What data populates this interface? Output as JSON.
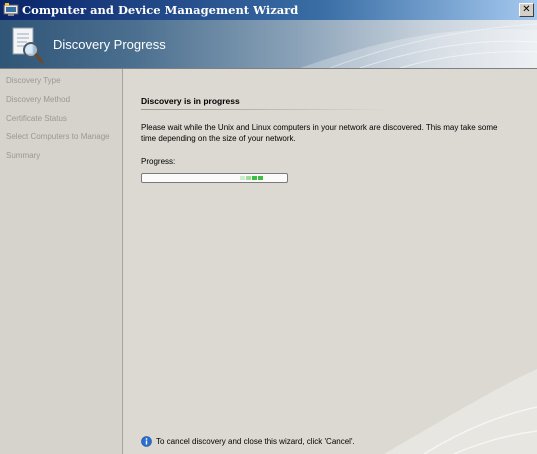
{
  "window": {
    "title": "Computer and Device Management Wizard",
    "close_glyph": "✕"
  },
  "header": {
    "title": "Discovery Progress",
    "icon": "wizard-document-search-icon"
  },
  "nav": {
    "items": [
      {
        "label": "Discovery Type"
      },
      {
        "label": "Discovery Method"
      },
      {
        "label": "Certificate Status"
      },
      {
        "label": "Select Computers to Manage"
      },
      {
        "label": "Summary"
      }
    ]
  },
  "main": {
    "section_title": "Discovery is in progress",
    "description": "Please wait while the Unix and Linux computers in your network are discovered. This may take some time depending on the size of your network.",
    "progress_label": "Progress:",
    "progress_indicator": "marquee",
    "info_icon": "info-icon",
    "info_text": "To cancel discovery and close this wizard, click 'Cancel'."
  },
  "colors": {
    "title_bar_start": "#0a246a",
    "title_bar_end": "#a6caf0",
    "progress_fill": "#3fbf3f"
  }
}
